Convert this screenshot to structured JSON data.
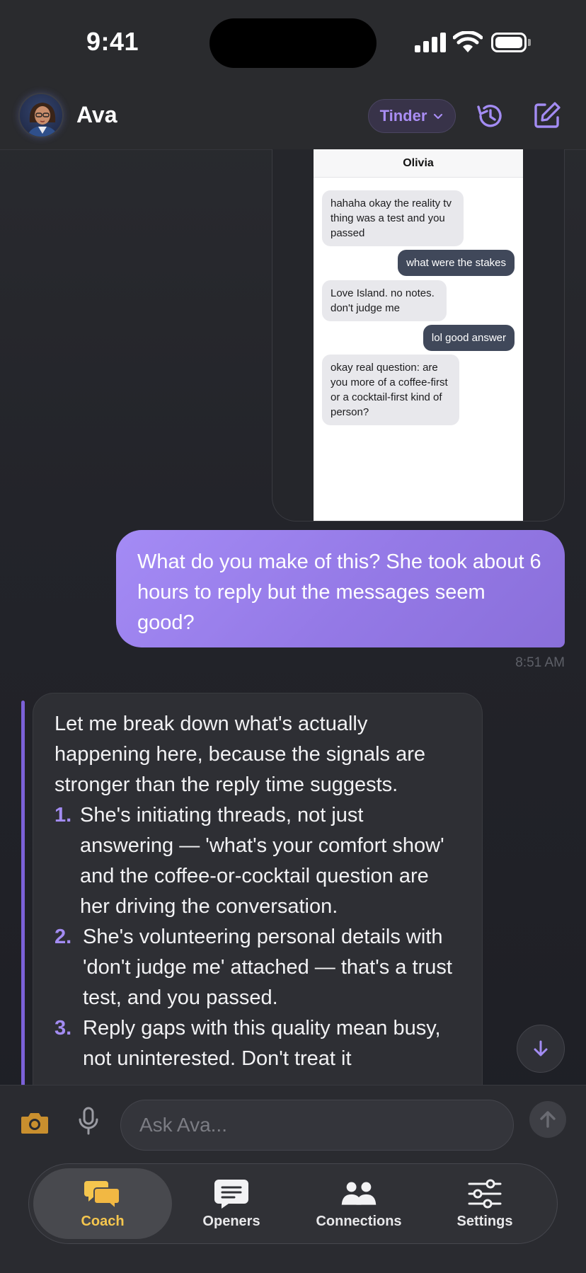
{
  "status_bar": {
    "time": "9:41"
  },
  "header": {
    "name": "Ava",
    "platform": "Tinder"
  },
  "screenshot": {
    "contact": "Olivia",
    "messages": [
      {
        "dir": "in",
        "text": "hahaha okay the reality tv thing was a test and you passed"
      },
      {
        "dir": "out",
        "text": "what were the stakes"
      },
      {
        "dir": "in",
        "text": "Love Island. no notes. don't judge me"
      },
      {
        "dir": "out",
        "text": "lol good answer"
      },
      {
        "dir": "in",
        "text": "okay real question: are you more of a coffee-first or a cocktail-first kind of person?"
      }
    ]
  },
  "user_message": {
    "text": "What do you make of this? She took about 6 hours to reply but the messages seem good?",
    "time": "8:51 AM"
  },
  "ai_message": {
    "intro": "Let me break down what's actually happening here, because the signals are stronger than the reply time suggests.",
    "points": [
      {
        "num": "1.",
        "text": "She's initiating threads, not just answering — 'what's your comfort show' and the coffee-or-cocktail question are her driving the conversation."
      },
      {
        "num": "2.",
        "text": "She's volunteering personal details with 'don't judge me' attached — that's a trust test, and you passed."
      },
      {
        "num": "3.",
        "text": "Reply gaps with this quality mean busy, not uninterested. Don't treat it"
      }
    ]
  },
  "composer": {
    "placeholder": "Ask Ava..."
  },
  "tabs": [
    {
      "label": "Coach",
      "active": true
    },
    {
      "label": "Openers",
      "active": false
    },
    {
      "label": "Connections",
      "active": false
    },
    {
      "label": "Settings",
      "active": false
    }
  ],
  "colors": {
    "accent": "#a38cf3",
    "active_tab": "#f5c64e",
    "user_bubble": "#9479e6"
  }
}
